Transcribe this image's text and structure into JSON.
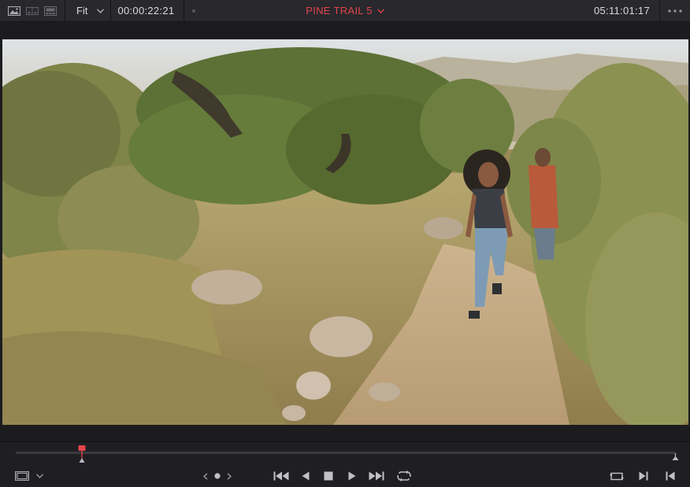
{
  "toolbar": {
    "view_icons": [
      "single-viewer-icon",
      "dual-viewer-icon",
      "cinema-viewer-icon"
    ],
    "zoom": "Fit",
    "source_timecode": "00:00:22:21",
    "clip_title": "PINE TRAIL 5",
    "record_timecode": "05:11:01:17",
    "more_icon": "more-options-icon"
  },
  "viewer": {
    "content": "video-frame"
  },
  "scrubber": {
    "playhead_fraction": 0.1
  },
  "transport": {
    "left": [
      "clip-view-icon",
      "chevron-down-icon"
    ],
    "jog": [
      "jog-left-icon",
      "jog-dot-icon",
      "jog-right-icon"
    ],
    "center": [
      "go-to-start-icon",
      "play-reverse-icon",
      "stop-icon",
      "play-icon",
      "go-to-end-icon",
      "loop-icon"
    ],
    "right": [
      "match-frame-icon",
      "next-edit-icon",
      "previous-edit-icon"
    ]
  },
  "colors": {
    "accent_red": "#e2454b",
    "panel": "#28282d",
    "background": "#1c1c1f"
  }
}
